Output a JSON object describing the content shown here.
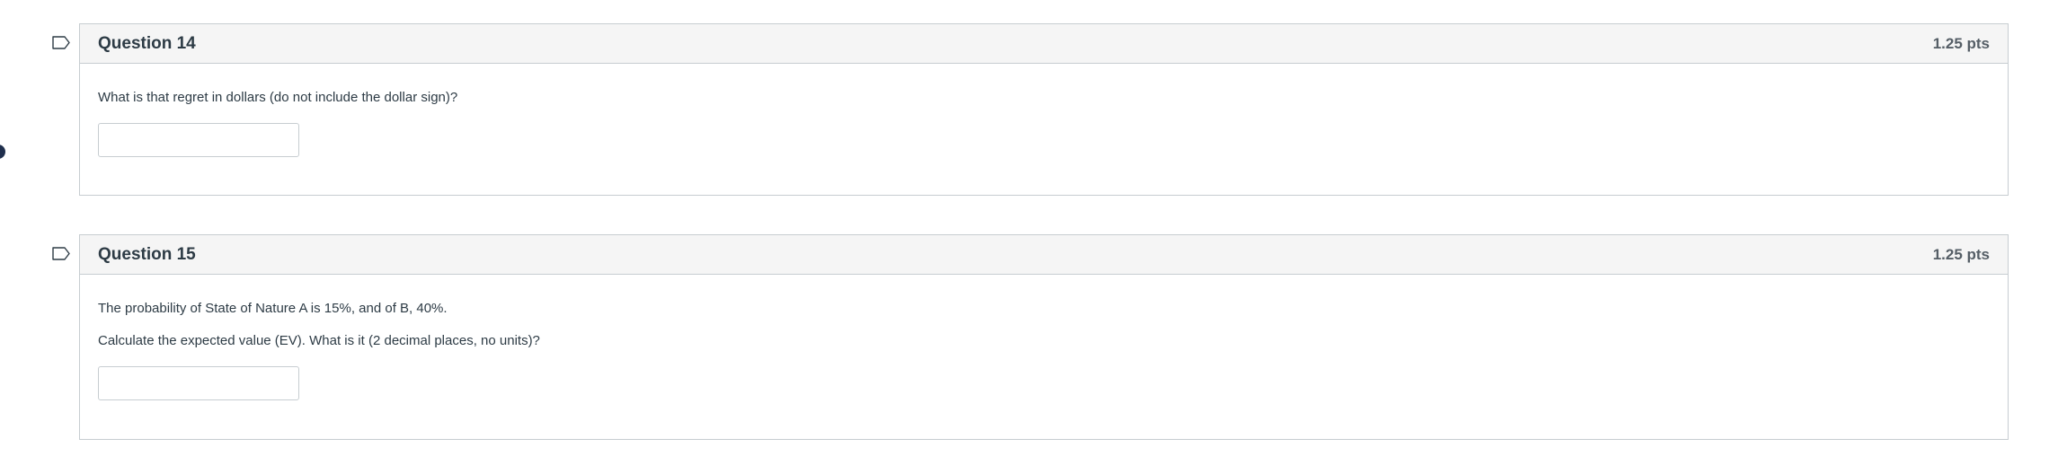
{
  "questions": [
    {
      "title": "Question 14",
      "points": "1.25 pts",
      "texts": [
        "What is that regret in dollars (do not include the dollar sign)?"
      ],
      "answer_value": ""
    },
    {
      "title": "Question 15",
      "points": "1.25 pts",
      "texts": [
        "The probability of State of Nature A is 15%, and of B, 40%.",
        "Calculate the expected value (EV). What is it (2 decimal places, no units)?"
      ],
      "answer_value": ""
    }
  ],
  "icons": {
    "flag": "flag-outline-icon",
    "side_marker": "navigation-dot"
  },
  "colors": {
    "header_bg": "#f5f5f5",
    "border": "#c7cdd1",
    "text": "#2d3b45",
    "dot": "#1f2f4d"
  }
}
